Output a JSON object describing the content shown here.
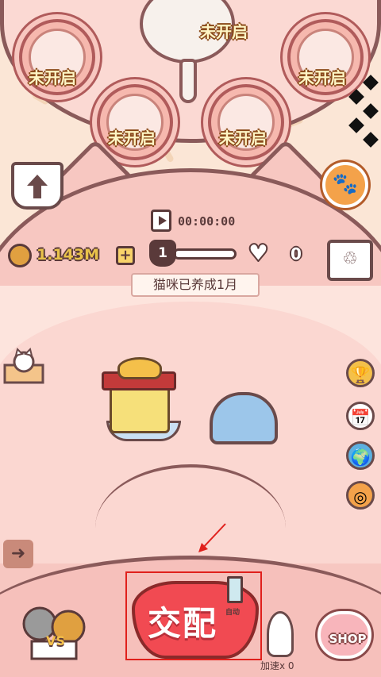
{
  "breeding_slots": [
    {
      "label": "未开启"
    },
    {
      "label": "未开启"
    },
    {
      "label": "未开启"
    },
    {
      "label": "未开启"
    },
    {
      "label": "未开启"
    }
  ],
  "status": {
    "timer": "00:00:00",
    "coins": "1.143M",
    "level": "1",
    "level_progress": 0,
    "hearts": "0",
    "cat_age": "猫咪已养成1月"
  },
  "bottom": {
    "mate_button": "交配",
    "auto_label": "自动",
    "speed_label": "加速x 0",
    "shop_label": "SHOP",
    "vs_label": "VS"
  },
  "colors": {
    "accent_red": "#f14a52",
    "outline_brown": "#8a5a5a",
    "coin_gold": "#e8c24a",
    "highlight_box": "#e0201c"
  }
}
